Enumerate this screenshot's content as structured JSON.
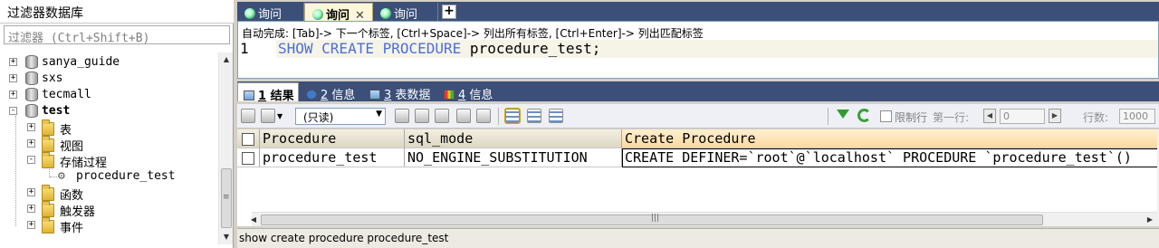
{
  "sidebar": {
    "title": "过滤器数据库",
    "filter_placeholder": "过滤器 (Ctrl+Shift+B)",
    "tree": {
      "databases": [
        {
          "label": "sanya_guide",
          "expander": "+"
        },
        {
          "label": "sxs",
          "expander": "+"
        },
        {
          "label": "tecmall",
          "expander": "+"
        },
        {
          "label": "test",
          "expander": "-"
        }
      ],
      "test_children": [
        {
          "label": "表",
          "expander": "+"
        },
        {
          "label": "视图",
          "expander": "+"
        },
        {
          "label": "存储过程",
          "expander": "-"
        },
        {
          "label": "函数",
          "expander": "+"
        },
        {
          "label": "触发器",
          "expander": "+"
        },
        {
          "label": "事件",
          "expander": "+"
        }
      ],
      "procedure": "procedure_test"
    }
  },
  "query_tabs": [
    {
      "label": "询问"
    },
    {
      "label": "询问",
      "close": "✕"
    },
    {
      "label": "询问"
    }
  ],
  "add_tab": "+",
  "editor": {
    "hint": "自动完成: [Tab]-> 下一个标签, [Ctrl+Space]-> 列出所有标签, [Ctrl+Enter]-> 列出匹配标签",
    "line_number": "1",
    "code_keyword": "SHOW CREATE PROCEDURE",
    "code_rest": " procedure_test;"
  },
  "result_tabs": [
    {
      "num": "1",
      "label": " 结果"
    },
    {
      "num": "2",
      "label": " 信息"
    },
    {
      "num": "3",
      "label": " 表数据"
    },
    {
      "num": "4",
      "label": " 信息"
    }
  ],
  "toolbar": {
    "mode": "(只读)",
    "dropdown_arrow": "▼",
    "limit_label": "限制行",
    "first_row_label": "第一行:",
    "first_row_value": "0",
    "rows_label": "行数:",
    "rows_value": "1000"
  },
  "grid": {
    "columns": [
      "Procedure",
      "sql_mode",
      "Create Procedure"
    ],
    "rows": [
      [
        "procedure_test",
        "NO_ENGINE_SUBSTITUTION",
        "CREATE DEFINER=`root`@`localhost` PROCEDURE `procedure_test`()"
      ]
    ]
  },
  "status": "show create procedure procedure_test",
  "colors": {
    "tab_bar": "#3b4f78",
    "keyword": "#4a6ee0",
    "active_tab": "#fdf7d8"
  }
}
